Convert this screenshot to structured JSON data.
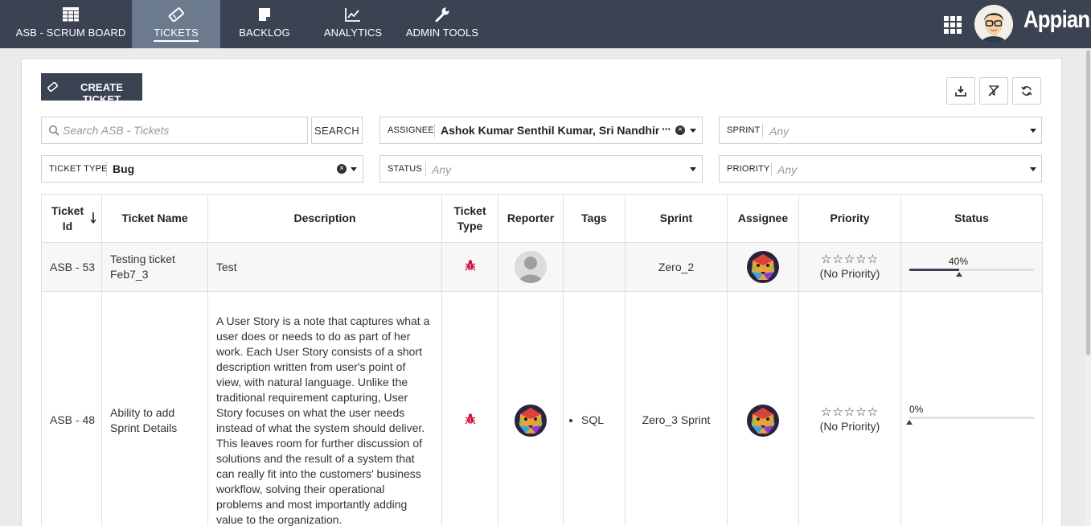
{
  "nav": {
    "tabs": [
      {
        "label": "ASB - SCRUM BOARD",
        "icon": "table-icon"
      },
      {
        "label": "TICKETS",
        "icon": "ticket-icon",
        "active": true
      },
      {
        "label": "BACKLOG",
        "icon": "note-icon"
      },
      {
        "label": "ANALYTICS",
        "icon": "chart-icon"
      },
      {
        "label": "ADMIN TOOLS",
        "icon": "wrench-icon"
      }
    ],
    "brand": "Appian"
  },
  "toolbar": {
    "create_label": "CREATE TICKET"
  },
  "filters": {
    "search_placeholder": "Search ASB - Tickets",
    "search_button": "SEARCH",
    "assignee_label": "ASSIGNEE",
    "assignee_value": "Ashok Kumar Senthil Kumar, Sri Nandhini S",
    "sprint_label": "SPRINT",
    "sprint_value": "Any",
    "ticket_type_label": "TICKET TYPE",
    "ticket_type_value": "Bug",
    "status_label": "STATUS",
    "status_value": "Any",
    "priority_label": "PRIORITY",
    "priority_value": "Any"
  },
  "table": {
    "headers": {
      "ticket_id": "Ticket Id",
      "ticket_name": "Ticket Name",
      "description": "Description",
      "ticket_type": "Ticket Type",
      "reporter": "Reporter",
      "tags": "Tags",
      "sprint": "Sprint",
      "assignee": "Assignee",
      "priority": "Priority",
      "status": "Status"
    },
    "rows": [
      {
        "id": "ASB - 53",
        "name": "Testing ticket Feb7_3",
        "description": "Test",
        "tag": "",
        "sprint": "Zero_2",
        "stars": "☆☆☆☆☆",
        "priority": "(No Priority)",
        "status_pct": "40%",
        "status_value": 0.4
      },
      {
        "id": "ASB - 48",
        "name": "Ability to add Sprint Details",
        "description": "A User Story is a note that captures what a user does or needs to do as part of her work. Each User Story consists of a short description written from user's point of view, with natural language. Unlike the traditional requirement capturing, User Story focuses on what the user needs instead of what the system should deliver. This leaves room for further discussion of solutions and the result of a system that can really fit into the customers' business workflow, solving their operational problems and most importantly adding value to the organization.",
        "tag": "SQL",
        "sprint": "Zero_3 Sprint",
        "stars": "☆☆☆☆☆",
        "priority": "(No Priority)",
        "status_pct": "0%",
        "status_value": 0
      }
    ]
  }
}
